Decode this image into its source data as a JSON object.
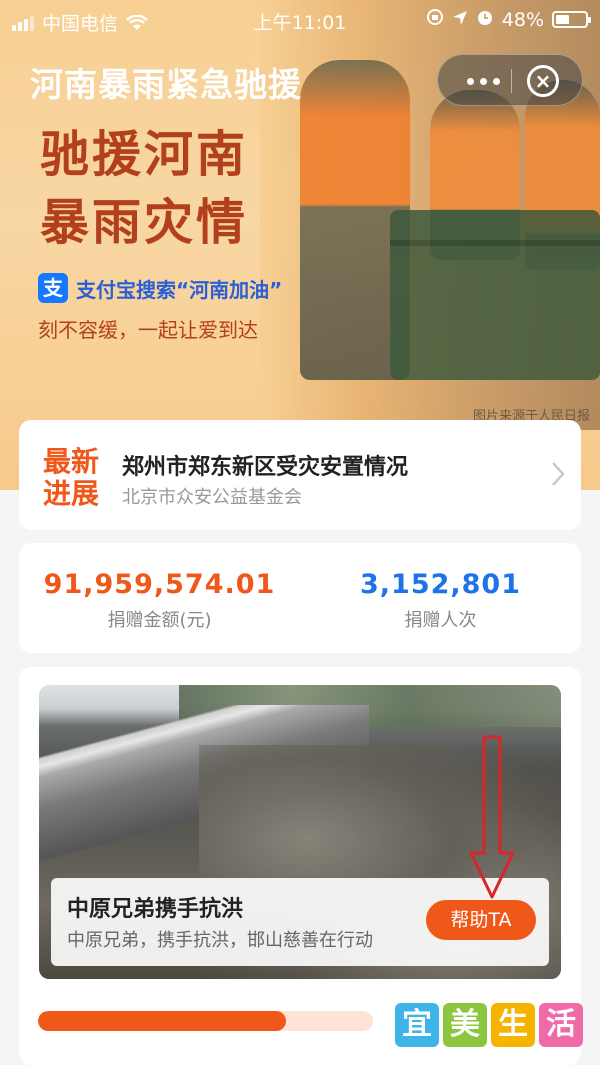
{
  "status_bar": {
    "carrier": "中国电信",
    "time": "上午11:01",
    "battery": "48%"
  },
  "banner": {
    "nav_title": "河南暴雨紧急驰援",
    "headline_1": "驰援河南",
    "headline_2": "暴雨灾情",
    "alipay_icon_glyph": "支",
    "search_text": "支付宝搜索“河南加油”",
    "slogan": "刻不容缓，一起让爱到达",
    "photo_credit": "图片来源于人民日报"
  },
  "news": {
    "badge_line1": "最新",
    "badge_line2": "进展",
    "title": "郑州市郑东新区受灾安置情况",
    "subtitle": "北京市众安公益基金会"
  },
  "stats": {
    "amount_value": "91,959,574.01",
    "amount_label": "捐赠金额(元)",
    "donors_value": "3,152,801",
    "donors_label": "捐赠人次"
  },
  "project": {
    "title": "中原兄弟携手抗洪",
    "subtitle": "中原兄弟，携手抗洪，邯山慈善在行动",
    "help_button": "帮助TA",
    "progress_fraction": 0.74
  },
  "watermark": {
    "chars": [
      "宜",
      "美",
      "生",
      "活"
    ]
  },
  "colors": {
    "accent": "#f0581a",
    "donor_blue": "#1e73e8",
    "headline": "#b3401c",
    "annotation_arrow": "#d6262a"
  }
}
